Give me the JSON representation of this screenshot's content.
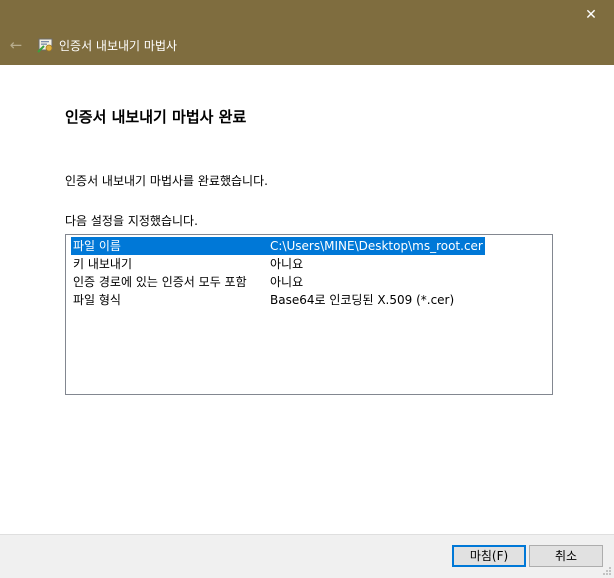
{
  "window": {
    "title": "인증서 내보내기 마법사",
    "close_glyph": "✕",
    "back_glyph": "←",
    "titlebar_color": "#7f6d3f"
  },
  "main": {
    "heading": "인증서 내보내기 마법사 완료",
    "completed_message": "인증서 내보내기 마법사를 완료했습니다.",
    "settings_label": "다음 설정을 지정했습니다.",
    "settings": [
      {
        "name": "파일 이름",
        "value": "C:\\Users\\MINE\\Desktop\\ms_root.cer"
      },
      {
        "name": "키 내보내기",
        "value": "아니요"
      },
      {
        "name": "인증 경로에 있는 인증서 모두 포함",
        "value": "아니요"
      },
      {
        "name": "파일 형식",
        "value": "Base64로 인코딩된 X.509 (*.cer)"
      }
    ],
    "selected_color": "#0078d7"
  },
  "footer": {
    "finish_label": "마침(F)",
    "cancel_label": "취소"
  }
}
